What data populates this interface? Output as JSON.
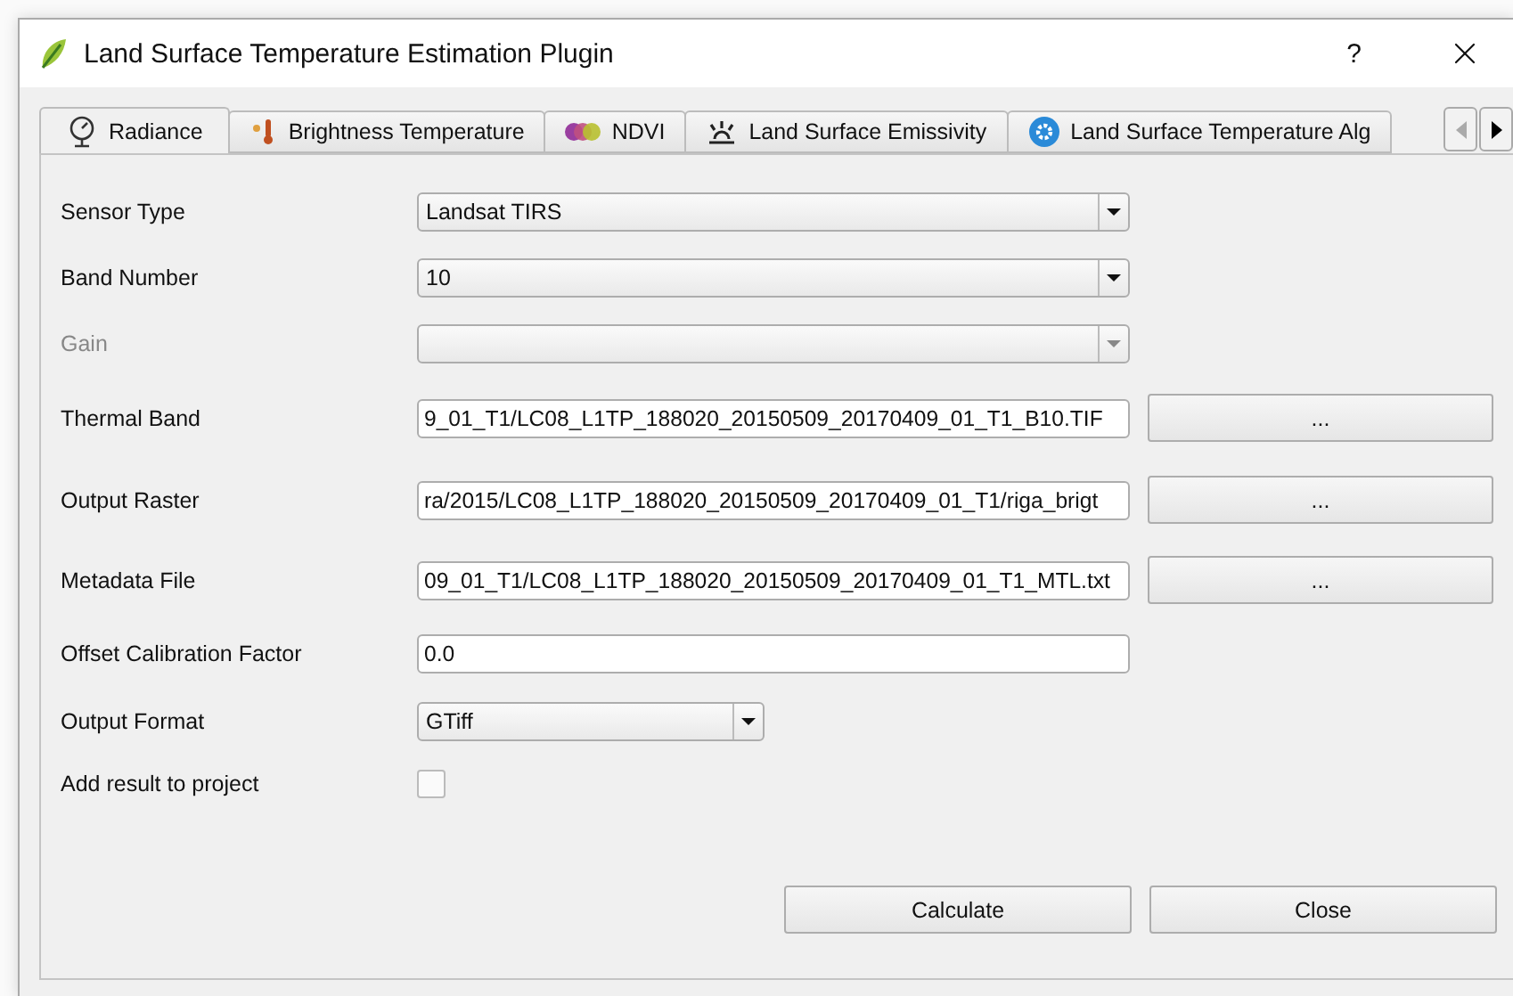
{
  "window": {
    "title": "Land Surface Temperature Estimation Plugin",
    "help": "?"
  },
  "tabs": [
    {
      "label": "Radiance",
      "selected": true
    },
    {
      "label": "Brightness Temperature",
      "selected": false
    },
    {
      "label": "NDVI",
      "selected": false
    },
    {
      "label": "Land Surface Emissivity",
      "selected": false
    },
    {
      "label": "Land Surface Temperature Alg",
      "selected": false
    }
  ],
  "tab_scroll": {
    "left_disabled": true
  },
  "rows": [
    {
      "kind": "combo",
      "label": "Sensor Type",
      "value": "Landsat TIRS",
      "disabled": false
    },
    {
      "kind": "combo",
      "label": "Band Number",
      "value": "10",
      "disabled": false
    },
    {
      "kind": "combo",
      "label": "Gain",
      "disabled": true
    },
    {
      "kind": "file",
      "label": "Thermal Band",
      "value": "9_01_T1/LC08_L1TP_188020_20150509_20170409_01_T1_B10.TIF",
      "button": "...",
      "disabled": false
    },
    {
      "kind": "file",
      "label": "Output Raster",
      "value": "ra/2015/LC08_L1TP_188020_20150509_20170409_01_T1/riga_brigt",
      "button": "...",
      "disabled": false
    },
    {
      "kind": "file",
      "label": "Metadata File",
      "value": "09_01_T1/LC08_L1TP_188020_20150509_20170409_01_T1_MTL.txt",
      "button": "...",
      "disabled": false
    },
    {
      "kind": "text",
      "label": "Offset Calibration Factor",
      "value": "0.0",
      "disabled": false
    },
    {
      "kind": "small_combo",
      "label": "Output Format",
      "value": "GTiff",
      "disabled": false
    },
    {
      "kind": "check",
      "label": "Add result to project",
      "checked": false,
      "disabled": false
    }
  ],
  "buttons": [
    "Calculate",
    "Close"
  ]
}
